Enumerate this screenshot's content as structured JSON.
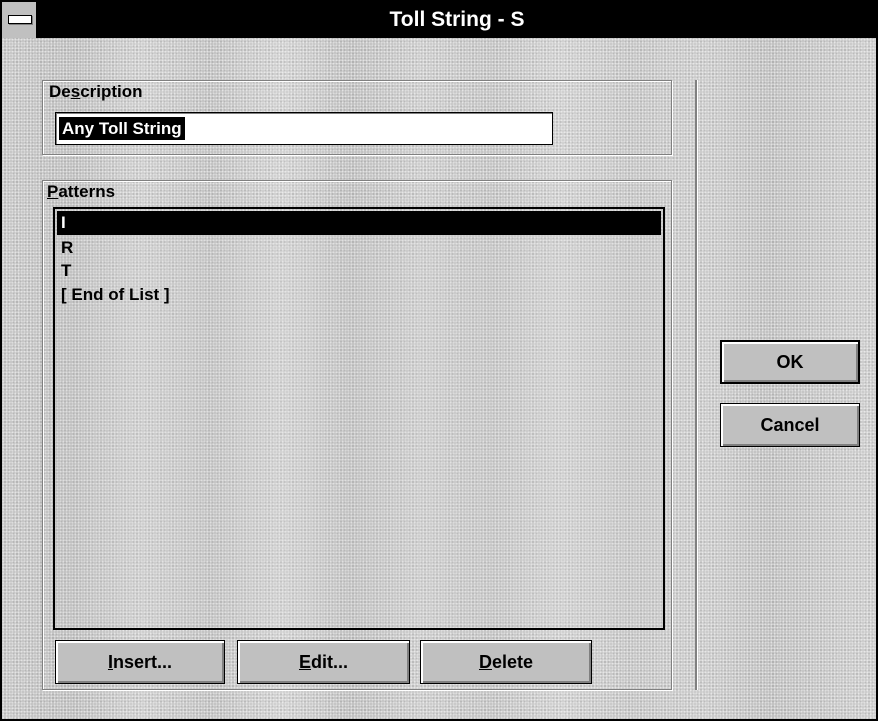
{
  "window": {
    "title": "Toll String - S"
  },
  "description": {
    "label": "Description",
    "value": "Any Toll String"
  },
  "patterns": {
    "label": "Patterns",
    "items": [
      {
        "label": "I",
        "selected": true
      },
      {
        "label": "R",
        "selected": false
      },
      {
        "label": "T",
        "selected": false
      },
      {
        "label": "[ End of List ]",
        "selected": false
      }
    ]
  },
  "buttons": {
    "insert": "Insert...",
    "edit": "Edit...",
    "delete": "Delete",
    "ok": "OK",
    "cancel": "Cancel"
  },
  "icons": {
    "system_menu": "system-menu-icon"
  }
}
